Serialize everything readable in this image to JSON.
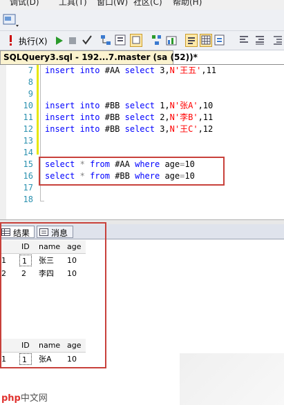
{
  "menu": [
    "调试(D)",
    "工具(T)",
    "窗口(W)",
    "社区(C)",
    "帮助(H)"
  ],
  "toolbar": {
    "execute_label": "执行(X)"
  },
  "document_tab": {
    "title": "SQLQuery3.sql - 192...7.master (sa (52))*"
  },
  "editor": {
    "lines": [
      {
        "n": "7",
        "tokens": [
          [
            "kw",
            "insert"
          ],
          [
            "t",
            " "
          ],
          [
            "kw",
            "into"
          ],
          [
            "t",
            " #AA "
          ],
          [
            "kw",
            "select"
          ],
          [
            "t",
            " 3,"
          ],
          [
            "str",
            "N'王五'"
          ],
          [
            "t",
            ",11"
          ]
        ]
      },
      {
        "n": "8",
        "tokens": []
      },
      {
        "n": "9",
        "tokens": []
      },
      {
        "n": "10",
        "tokens": [
          [
            "kw",
            "insert"
          ],
          [
            "t",
            " "
          ],
          [
            "kw",
            "into"
          ],
          [
            "t",
            " #BB "
          ],
          [
            "kw",
            "select"
          ],
          [
            "t",
            " 1,"
          ],
          [
            "str",
            "N'张A'"
          ],
          [
            "t",
            ",10"
          ]
        ]
      },
      {
        "n": "11",
        "tokens": [
          [
            "kw",
            "insert"
          ],
          [
            "t",
            " "
          ],
          [
            "kw",
            "into"
          ],
          [
            "t",
            " #BB "
          ],
          [
            "kw",
            "select"
          ],
          [
            "t",
            " 2,"
          ],
          [
            "str",
            "N'李B'"
          ],
          [
            "t",
            ",11"
          ]
        ]
      },
      {
        "n": "12",
        "tokens": [
          [
            "kw",
            "insert"
          ],
          [
            "t",
            " "
          ],
          [
            "kw",
            "into"
          ],
          [
            "t",
            " #BB "
          ],
          [
            "kw",
            "select"
          ],
          [
            "t",
            " 3,"
          ],
          [
            "str",
            "N'王C'"
          ],
          [
            "t",
            ",12"
          ]
        ]
      },
      {
        "n": "13",
        "tokens": []
      },
      {
        "n": "14",
        "tokens": []
      },
      {
        "n": "15",
        "tokens": [
          [
            "kw",
            "select"
          ],
          [
            "t",
            " "
          ],
          [
            "op",
            "*"
          ],
          [
            "t",
            " "
          ],
          [
            "kw",
            "from"
          ],
          [
            "t",
            " #AA "
          ],
          [
            "kw",
            "where"
          ],
          [
            "t",
            " age"
          ],
          [
            "op",
            "="
          ],
          [
            "t",
            "10"
          ]
        ]
      },
      {
        "n": "16",
        "tokens": [
          [
            "kw",
            "select"
          ],
          [
            "t",
            " "
          ],
          [
            "op",
            "*"
          ],
          [
            "t",
            " "
          ],
          [
            "kw",
            "from"
          ],
          [
            "t",
            " #BB "
          ],
          [
            "kw",
            "where"
          ],
          [
            "t",
            " age"
          ],
          [
            "op",
            "="
          ],
          [
            "t",
            "10"
          ]
        ]
      },
      {
        "n": "17",
        "tokens": []
      },
      {
        "n": "18",
        "tokens": []
      }
    ]
  },
  "result_tabs": {
    "results": "结果",
    "messages": "消息"
  },
  "grid1": {
    "columns": [
      "ID",
      "name",
      "age"
    ],
    "rows": [
      {
        "rownum": "1",
        "cells": [
          "1",
          "张三",
          "10"
        ]
      },
      {
        "rownum": "2",
        "cells": [
          "2",
          "李四",
          "10"
        ]
      }
    ]
  },
  "grid2": {
    "columns": [
      "ID",
      "name",
      "age"
    ],
    "rows": [
      {
        "rownum": "1",
        "cells": [
          "1",
          "张A",
          "10"
        ]
      }
    ]
  },
  "watermark": {
    "brand": "php",
    "site": "中文网"
  },
  "colors": {
    "keyword": "#0000ff",
    "string": "#ff0000",
    "operator": "#808080",
    "line_number": "#2b91af",
    "highlight_box": "#c8403a"
  }
}
